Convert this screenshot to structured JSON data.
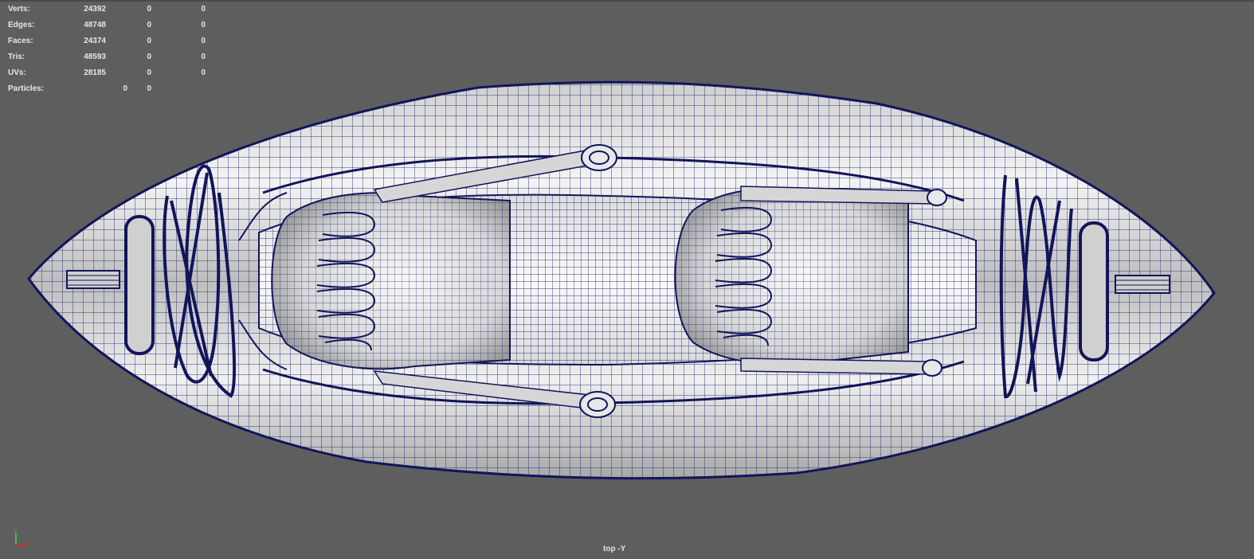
{
  "hud": {
    "rows": [
      {
        "label": "Verts:",
        "v1": "24392",
        "v2": "0",
        "v3": "0"
      },
      {
        "label": "Edges:",
        "v1": "48748",
        "v2": "0",
        "v3": "0"
      },
      {
        "label": "Faces:",
        "v1": "24374",
        "v2": "0",
        "v3": "0"
      },
      {
        "label": "Tris:",
        "v1": "48593",
        "v2": "0",
        "v3": "0"
      },
      {
        "label": "UVs:",
        "v1": "28185",
        "v2": "0",
        "v3": "0"
      }
    ],
    "particles": {
      "label": "Particles:",
      "v1": "0",
      "v2": "0"
    }
  },
  "camera_label": "top -Y",
  "axis": {
    "y": "Y",
    "x": "X"
  },
  "colors": {
    "viewport_bg": "#5e5e5e",
    "wire": "#1c1f6e",
    "shade_light": "#f2f2f2",
    "shade_mid": "#bdbdbd",
    "shade_dark": "#7d7d7d"
  },
  "model": {
    "icon": "inflatable-kayak-wireframe"
  }
}
